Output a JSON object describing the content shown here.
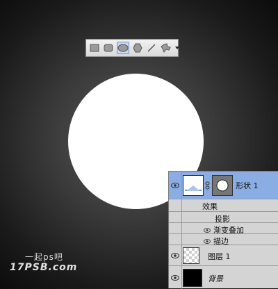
{
  "toolbar": {
    "tools": [
      {
        "icon": "rectangle-tool-icon"
      },
      {
        "icon": "rounded-rectangle-tool-icon"
      },
      {
        "icon": "ellipse-tool-icon",
        "active": true
      },
      {
        "icon": "polygon-tool-icon"
      },
      {
        "icon": "line-tool-icon"
      },
      {
        "icon": "custom-shape-tool-icon"
      }
    ]
  },
  "layers": {
    "shape_layer_name": "形状 1",
    "effects_label": "效果",
    "effects": [
      "投影",
      "渐变叠加",
      "描边"
    ],
    "layer1_name": "图层 1",
    "background_name": "背景"
  },
  "watermark": {
    "top": "一起ps吧",
    "bottom": "17PSB.com"
  },
  "colors": {
    "selected_row": "#8aaee4",
    "panel_bg": "#d4d4d4",
    "circle": "#ffffff"
  }
}
